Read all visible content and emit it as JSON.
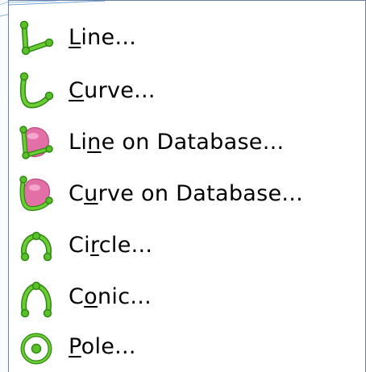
{
  "menu": {
    "items": [
      {
        "icon": "line-icon",
        "label_pre": "",
        "label_mnemonic": "L",
        "label_post": "ine..."
      },
      {
        "icon": "curve-icon",
        "label_pre": "",
        "label_mnemonic": "C",
        "label_post": "urve..."
      },
      {
        "icon": "line-on-database-icon",
        "label_pre": "Li",
        "label_mnemonic": "n",
        "label_post": "e on Database..."
      },
      {
        "icon": "curve-on-database-icon",
        "label_pre": "C",
        "label_mnemonic": "u",
        "label_post": "rve on Database..."
      },
      {
        "icon": "circle-icon",
        "label_pre": "Ci",
        "label_mnemonic": "r",
        "label_post": "cle..."
      },
      {
        "icon": "conic-icon",
        "label_pre": "C",
        "label_mnemonic": "o",
        "label_post": "nic..."
      },
      {
        "icon": "pole-icon",
        "label_pre": "",
        "label_mnemonic": "P",
        "label_post": "ole..."
      }
    ]
  },
  "colors": {
    "icon_green": "#5bbf2a",
    "icon_green_dark": "#2e8a12",
    "database_pink": "#e36fa7",
    "border": "#6a7fa6"
  }
}
